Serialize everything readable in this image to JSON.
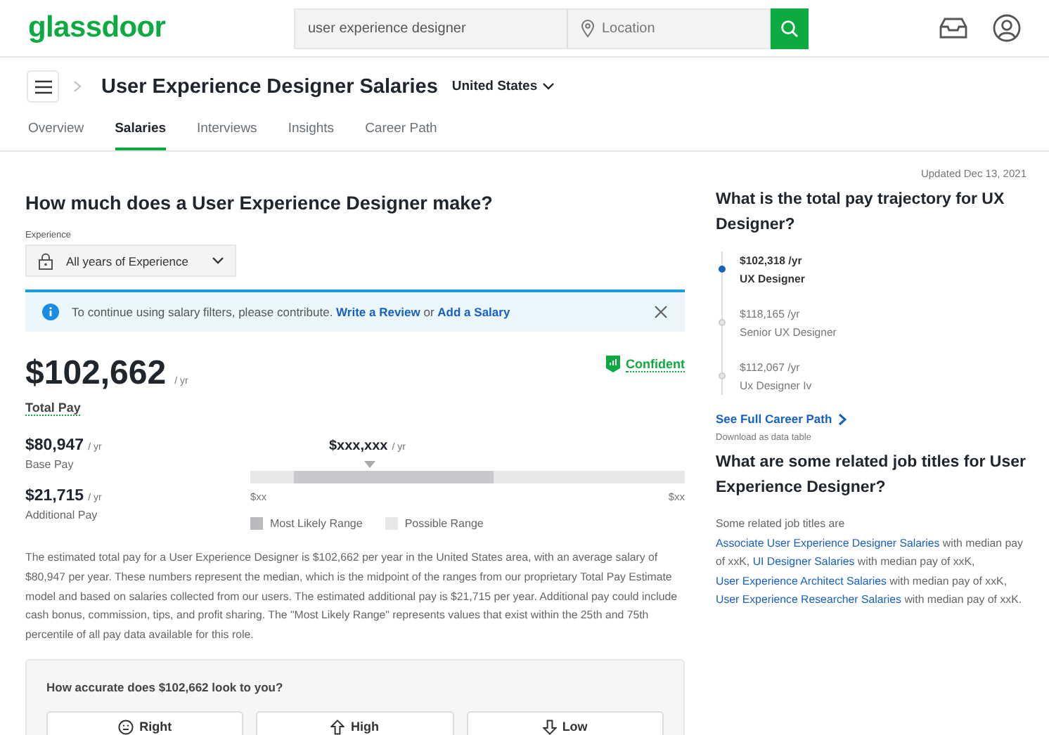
{
  "header": {
    "logo": "glassdoor",
    "search": {
      "value": "user experience designer"
    },
    "location": {
      "placeholder": "Location"
    }
  },
  "page": {
    "title": "User Experience Designer Salaries",
    "country": "United States"
  },
  "tabs": [
    {
      "label": "Overview",
      "selected": false
    },
    {
      "label": "Salaries",
      "selected": true
    },
    {
      "label": "Interviews",
      "selected": false
    },
    {
      "label": "Insights",
      "selected": false
    },
    {
      "label": "Career Path",
      "selected": false
    }
  ],
  "updated": "Updated Dec 13, 2021",
  "main": {
    "heading": "How much does a User Experience Designer make?",
    "filter": {
      "label": "Experience",
      "value": "All years of Experience"
    },
    "banner": [
      {
        "kind": "text",
        "text": "To continue using salary filters, please contribute. "
      },
      {
        "kind": "link",
        "text": "Write a Review"
      },
      {
        "kind": "text",
        "text": " or "
      },
      {
        "kind": "link",
        "text": "Add a Salary"
      }
    ],
    "confidence": "Confident",
    "total": {
      "amount": "$102,662",
      "unit": "/ yr",
      "label": "Total Pay"
    },
    "breakdown": [
      {
        "amount": "$80,947",
        "unit": "/ yr",
        "label": "Base Pay"
      },
      {
        "amount": "$21,715",
        "unit": "/ yr",
        "label": "Additional Pay"
      }
    ],
    "range": {
      "median": "$xxx,xxx",
      "unit": "/ yr",
      "min": "$xx",
      "max": "$xx",
      "legend": [
        "Most Likely Range",
        "Possible Range"
      ]
    },
    "description": "The estimated total pay for a User Experience Designer is $102,662 per year in the United States area, with an average salary of $80,947 per year. These numbers represent the median, which is the midpoint of the ranges from our proprietary Total Pay Estimate model and based on salaries collected from our users. The estimated additional pay is $21,715 per year. Additional pay could include cash bonus, commission, tips, and profit sharing. The \"Most Likely Range\" represents values that exist within the 25th and 75th percentile of all pay data available for this role.",
    "feedback": {
      "question": "How accurate does $102,662 look to you?",
      "options": [
        {
          "kind": "right",
          "label": "Right"
        },
        {
          "kind": "high",
          "label": "High"
        },
        {
          "kind": "low",
          "label": "Low"
        }
      ]
    }
  },
  "side": {
    "trajectory_heading": "What is the total pay trajectory for UX Designer?",
    "trajectory": [
      {
        "pay": "$102,318 /yr",
        "title": "UX Designer",
        "current": true
      },
      {
        "pay": "$118,165 /yr",
        "title": "Senior UX Designer",
        "current": false
      },
      {
        "pay": "$112,067 /yr",
        "title": "Ux Designer Iv",
        "current": false
      }
    ],
    "career_link": "See Full Career Path",
    "download": "Download as data table",
    "related_heading": "What are some related job titles for User Experience Designer?",
    "related": [
      {
        "kind": "text",
        "text": "Some related job titles are "
      },
      {
        "kind": "link",
        "text": "Associate User Experience Designer Salaries"
      },
      {
        "kind": "text",
        "text": " with median pay of xxK, "
      },
      {
        "kind": "link",
        "text": "UI Designer Salaries"
      },
      {
        "kind": "text",
        "text": " with median pay of xxK, "
      },
      {
        "kind": "link",
        "text": "User Experience Architect Salaries"
      },
      {
        "kind": "text",
        "text": " with median pay of xxK, "
      },
      {
        "kind": "link",
        "text": "User Experience Researcher Salaries"
      },
      {
        "kind": "text",
        "text": " with median pay of xxK."
      }
    ]
  }
}
